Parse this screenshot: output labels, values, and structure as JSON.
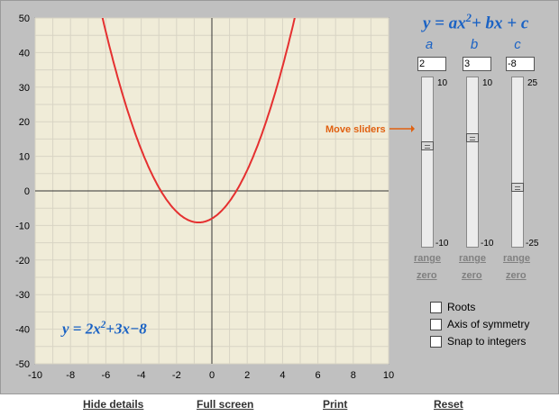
{
  "graph": {
    "x_ticks": [
      "-10",
      "-8",
      "-6",
      "-4",
      "-2",
      "0",
      "2",
      "4",
      "6",
      "8",
      "10"
    ],
    "y_ticks": [
      "50",
      "40",
      "30",
      "20",
      "10",
      "0",
      "-10",
      "-20",
      "-30",
      "-40",
      "-50"
    ],
    "x_range": [
      -10,
      10
    ],
    "y_range": [
      -50,
      50
    ],
    "grid": true,
    "background": "#f0ecd8",
    "curve_color": "#e53030",
    "curve_coefficients": {
      "a": 2,
      "b": 3,
      "c": -8
    },
    "equation_label": {
      "prefix": "y = 2x",
      "exp": "2",
      "suffix": "+3x−8"
    }
  },
  "controls": {
    "general_equation": {
      "lhs": "y = ax",
      "exp": "2",
      "rhs": "+ bx + c"
    },
    "move_sliders_label": "Move sliders",
    "sliders": [
      {
        "name": "a",
        "value": "2",
        "max": "10",
        "min": "-10",
        "level": 0.6,
        "range_label": "range",
        "zero_label": "zero"
      },
      {
        "name": "b",
        "value": "3",
        "max": "10",
        "min": "-10",
        "level": 0.65,
        "range_label": "range",
        "zero_label": "zero"
      },
      {
        "name": "c",
        "value": "-8",
        "max": "25",
        "min": "-25",
        "level": 0.34,
        "range_label": "range",
        "zero_label": "zero"
      }
    ],
    "checkboxes": [
      {
        "label": "Roots",
        "checked": false
      },
      {
        "label": "Axis of symmetry",
        "checked": false
      },
      {
        "label": "Snap to integers",
        "checked": false
      }
    ]
  },
  "bottom_links": {
    "hide_details": "Hide details",
    "full_screen": "Full screen",
    "print": "Print",
    "reset": "Reset"
  },
  "colors": {
    "accent_blue": "#1a62c4",
    "orange": "#e06010",
    "panel_gray": "#c0c0c0"
  }
}
